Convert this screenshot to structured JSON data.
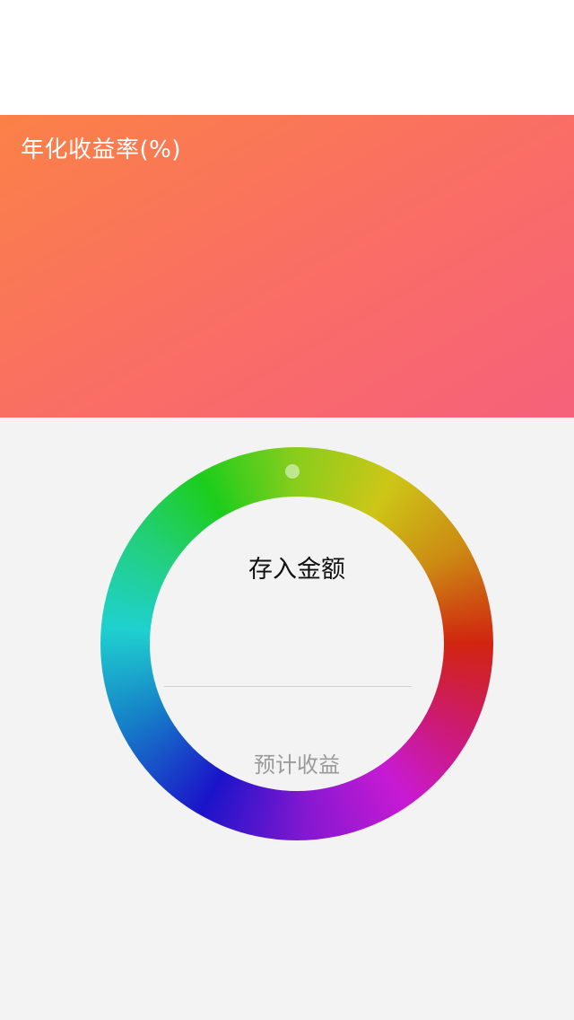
{
  "header": {
    "rate_label": "年化收益率(%)"
  },
  "dial": {
    "deposit_label": "存入金额",
    "amount_value": "",
    "amount_placeholder": "",
    "income_label": "预计收益"
  },
  "colors": {
    "panel_gradient_start": "#fb8147",
    "panel_gradient_end": "#f6617a",
    "background": "#f4f3f4",
    "ring_colors": [
      "#8acd1c",
      "#cdc617",
      "#d12410",
      "#c81ad3",
      "#1a14c9",
      "#1fd1cf",
      "#1ccd1c"
    ]
  }
}
